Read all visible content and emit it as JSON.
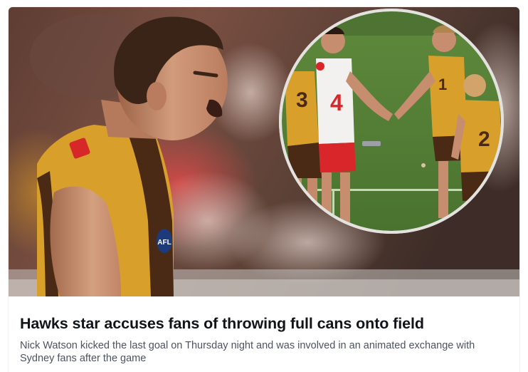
{
  "article": {
    "headline": "Hawks star accuses fans of throwing full cans onto field",
    "summary": "Nick Watson kicked the last goal on Thursday night and was involved in an animated exchange with Sydney fans after the game"
  },
  "image": {
    "main_player_jumper_badge": "AFL",
    "inset_jumper_numbers": [
      "3",
      "4",
      "1",
      "2"
    ]
  },
  "colors": {
    "hawthorn_gold": "#d8a02a",
    "hawthorn_brown": "#4a2a14",
    "sydney_red": "#d8262b",
    "headline_text": "#111418",
    "summary_text": "#4c5360"
  }
}
